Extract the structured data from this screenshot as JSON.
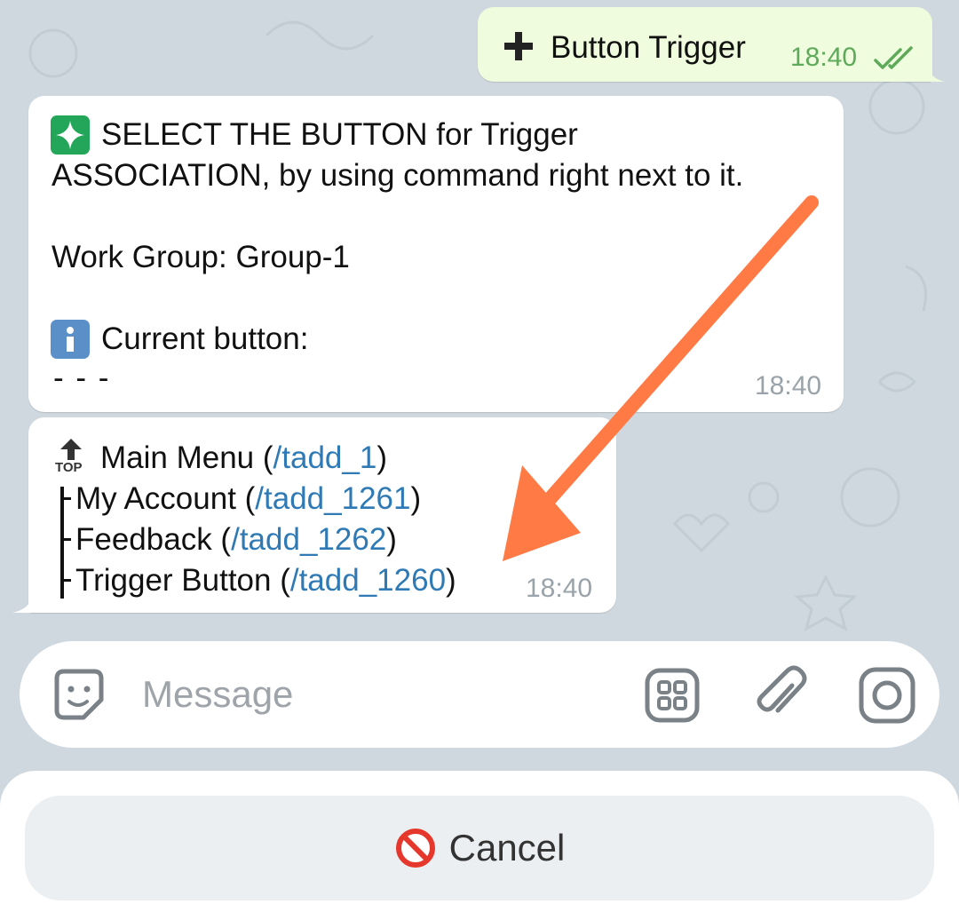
{
  "outgoing": {
    "text": "Button Trigger",
    "time": "18:40",
    "icon": "plus-icon",
    "status_icon": "double-check-icon"
  },
  "message1": {
    "line1": "SELECT THE BUTTON for Trigger",
    "line2": "ASSOCIATION, by using command right next to it.",
    "line3": "Work Group: Group-1",
    "line4": "Current button:",
    "line5": "- - -",
    "time": "18:40"
  },
  "message2": {
    "rows": [
      {
        "label": "Main Menu (",
        "cmd": "/tadd_1",
        "close": ")"
      },
      {
        "label": "My Account (",
        "cmd": "/tadd_1261",
        "close": ")"
      },
      {
        "label": "Feedback (",
        "cmd": "/tadd_1262",
        "close": ")"
      },
      {
        "label": "Trigger Button (",
        "cmd": "/tadd_1260",
        "close": ")"
      }
    ],
    "top_icon_text": "TOP",
    "time": "18:40"
  },
  "input": {
    "placeholder": "Message"
  },
  "keyboard": {
    "cancel_label": "Cancel"
  },
  "colors": {
    "background": "#cfd8df",
    "outgoing_bubble": "#effdde",
    "link": "#2f7ab4",
    "arrow": "#ff7a45"
  }
}
